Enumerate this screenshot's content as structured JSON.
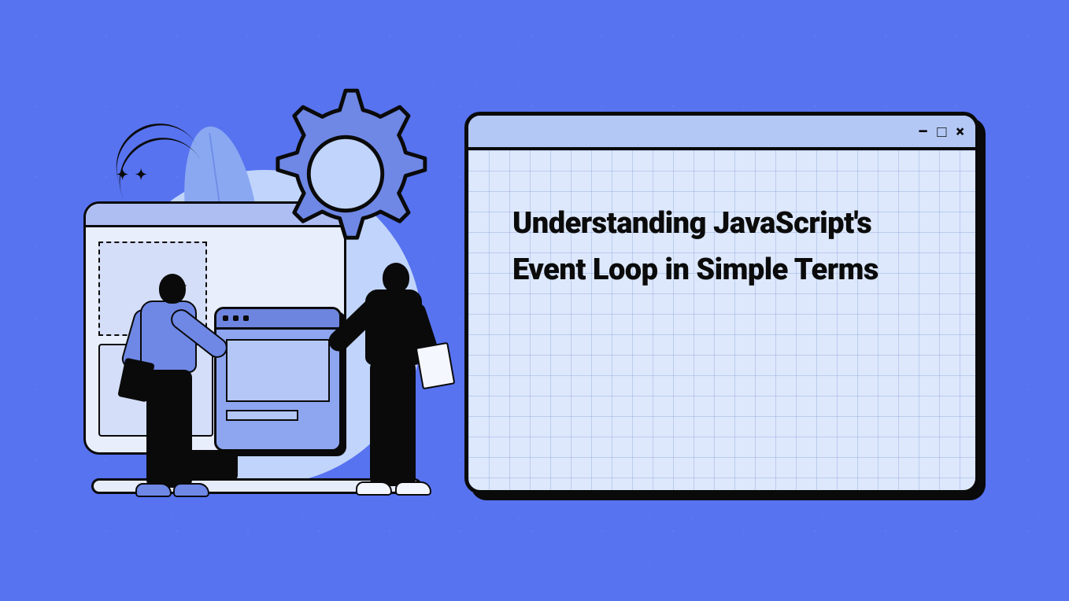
{
  "colors": {
    "background": "#5773f0",
    "card_bg": "#dde8fc",
    "titlebar_bg": "#b4c8f6",
    "outline": "#0a0a0a",
    "accent": "#6f88e6",
    "light_accent": "#c1d4fb"
  },
  "card": {
    "heading": "Understanding JavaScript's Event Loop in Simple Terms",
    "controls": {
      "minimize": "–",
      "maximize": "□",
      "close": "×"
    }
  },
  "illustration": {
    "gear_icon": "gear-icon",
    "monitor_icon": "monitor-icon",
    "mini_window_icon": "app-window-icon",
    "person_left": "developer-pointing-icon",
    "person_right": "developer-with-paper-icon",
    "leaf_icon": "leaf-icon"
  }
}
